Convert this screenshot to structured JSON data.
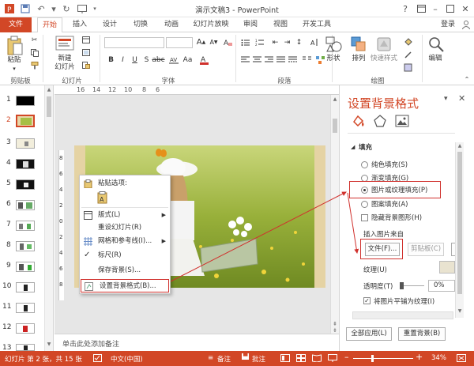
{
  "window": {
    "title": "演示文稿3 - PowerPoint",
    "help": "?",
    "login": "登录"
  },
  "tabs": [
    {
      "label": "文件"
    },
    {
      "label": "开始"
    },
    {
      "label": "插入"
    },
    {
      "label": "设计"
    },
    {
      "label": "切换"
    },
    {
      "label": "动画"
    },
    {
      "label": "幻灯片放映"
    },
    {
      "label": "审阅"
    },
    {
      "label": "视图"
    },
    {
      "label": "开发工具"
    }
  ],
  "ribbon": {
    "groups": {
      "clipboard": "剪贴板",
      "slides": "幻灯片",
      "font": "字体",
      "paragraph": "段落",
      "drawing": "绘图"
    },
    "paste": "粘贴",
    "new_slide": "新建\n幻灯片",
    "shape": "形状",
    "arrange": "排列",
    "quick_styles": "快速样式",
    "edit": "编辑",
    "font_size": "",
    "bold": "B",
    "italic": "I",
    "underline": "U",
    "strike": "S",
    "font_a": "A"
  },
  "ruler": {
    "h_ticks": [
      "16",
      "14",
      "12",
      "10",
      "8",
      "6"
    ],
    "v_ticks": [
      "8",
      "6",
      "4",
      "2",
      "0",
      "2",
      "4",
      "6",
      "8"
    ]
  },
  "slides": [
    {
      "num": "1"
    },
    {
      "num": "2"
    },
    {
      "num": "3"
    },
    {
      "num": "4"
    },
    {
      "num": "5"
    },
    {
      "num": "6"
    },
    {
      "num": "7"
    },
    {
      "num": "8"
    },
    {
      "num": "9"
    },
    {
      "num": "10"
    },
    {
      "num": "11"
    },
    {
      "num": "12"
    },
    {
      "num": "13"
    }
  ],
  "context_menu": {
    "paste_options": "粘贴选项:",
    "items": [
      {
        "label": "版式(L)"
      },
      {
        "label": "重设幻灯片(R)"
      },
      {
        "label": "网格和参考线(I)..."
      },
      {
        "label": "标尺(R)"
      },
      {
        "label": "保存背景(S)..."
      },
      {
        "label": "设置背景格式(B)..."
      }
    ]
  },
  "notes_placeholder": "单击此处添加备注",
  "format_pane": {
    "title": "设置背景格式",
    "section": "填充",
    "options": [
      {
        "label": "纯色填充(S)"
      },
      {
        "label": "渐变填充(G)"
      },
      {
        "label": "图片或纹理填充(P)"
      },
      {
        "label": "图案填充(A)"
      }
    ],
    "hide_bg": "隐藏背景图形(H)",
    "insert_from": "插入图片来自",
    "file_btn": "文件(F)...",
    "clipboard_btn": "剪贴板(C)",
    "texture": "纹理(U)",
    "transparency": "透明度(T)",
    "transparency_value": "0%",
    "tile": "将图片平铺为纹理(I)",
    "apply_all": "全部应用(L)",
    "reset": "重置背景(B)"
  },
  "status": {
    "slide_info": "幻灯片 第 2 张，共 15 张",
    "language": "中文(中国)",
    "notes": "备注",
    "comments": "批注",
    "zoom": "34%"
  }
}
